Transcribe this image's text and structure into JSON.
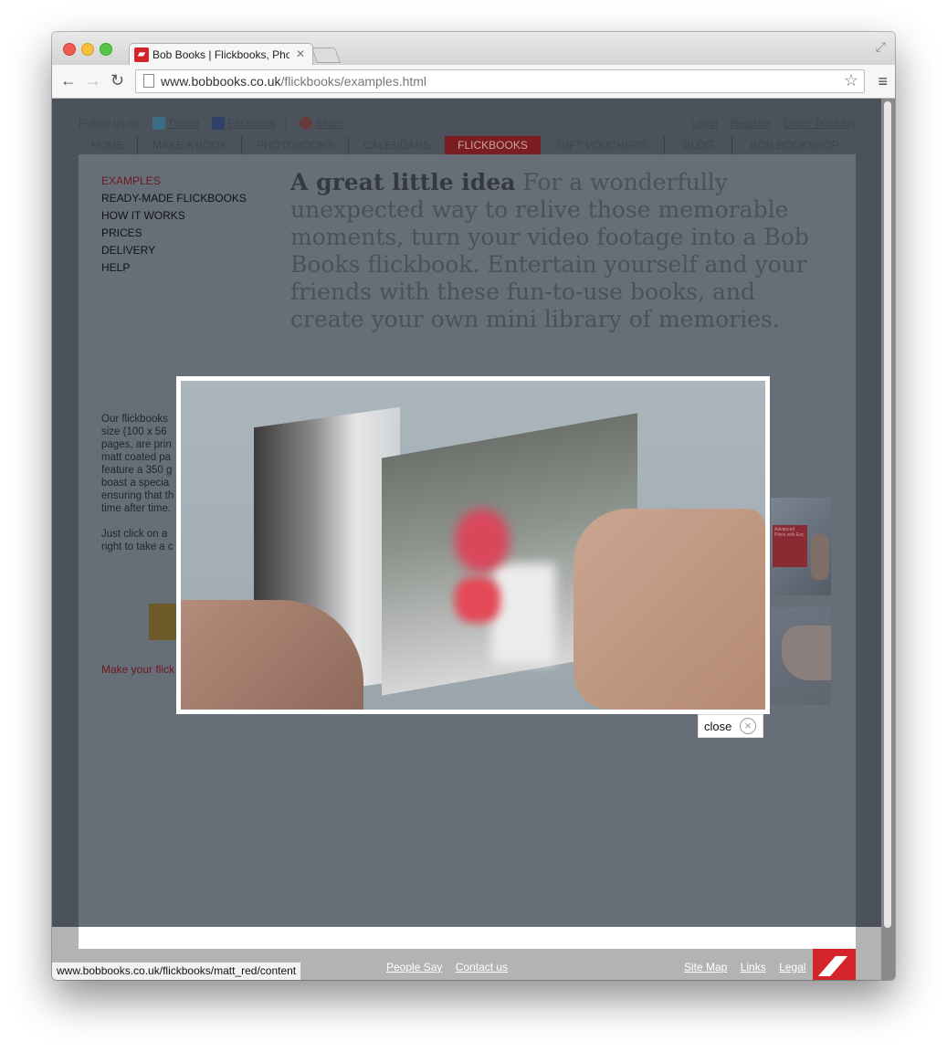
{
  "browser": {
    "tab_title": "Bob Books | Flickbooks, Photo",
    "favicon_text": "▰",
    "url_domain": "www.bobbooks.co.uk",
    "url_path": "/flickbooks/examples.html",
    "status_url": "www.bobbooks.co.uk/flickbooks/matt_red/content"
  },
  "social": {
    "follow_label": "Follow us on",
    "twitter": "Twitter",
    "facebook": "Facebook",
    "separator": "|",
    "share": "Share"
  },
  "account": {
    "login": "Login",
    "register": "Register",
    "order_tracking": "Order Tracking"
  },
  "mainnav": [
    "HOME",
    "MAKE A BOOK",
    "PHOTOBOOKS",
    "CALENDARS",
    "FLICKBOOKS",
    "GIFT VOUCHERS",
    "BLOG",
    "BOB BOOKSHOP"
  ],
  "sidenav": [
    "EXAMPLES",
    "READY-MADE FLICKBOOKS",
    "HOW IT WORKS",
    "PRICES",
    "DELIVERY",
    "HELP"
  ],
  "headline": {
    "bold": "A great little idea",
    "rest": " For a wonderfully unexpected way to relive those memorable moments, turn your video footage into a Bob Books flickbook. Entertain yourself and your friends with these fun-to-use books, and create your own mini library of memories."
  },
  "body": {
    "paragraph": "Our flickbooks\nsize (100 x 56\npages, are prin\nmatt coated pa\nfeature a 350 g\nboast a specia\nensuring that th\ntime after time.",
    "click": "Just click on a\nright to take a c",
    "make_link": "Make your flick"
  },
  "thumb_text": "Advanced Pilots with Eric",
  "footer": {
    "left_links": [
      "People Say",
      "Contact us"
    ],
    "right_links": [
      "Site Map",
      "Links",
      "Legal"
    ]
  },
  "lightbox": {
    "close_label": "close",
    "close_icon": "×"
  }
}
